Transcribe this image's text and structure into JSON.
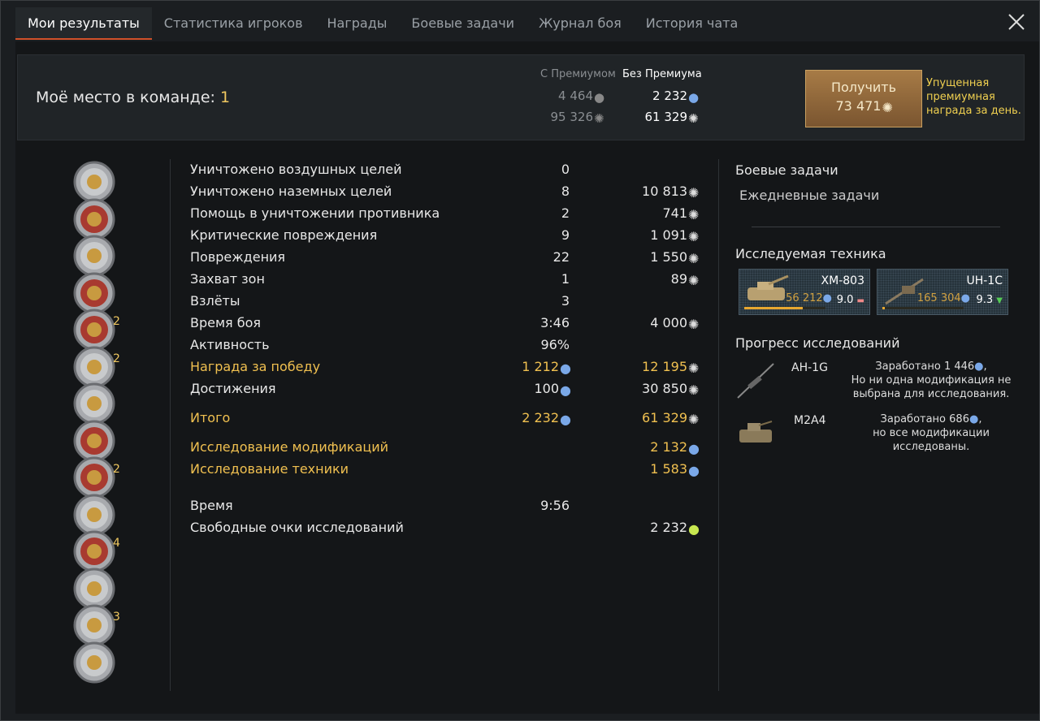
{
  "tabs": [
    {
      "label": "Мои результаты",
      "active": true
    },
    {
      "label": "Статистика игроков"
    },
    {
      "label": "Награды"
    },
    {
      "label": "Боевые задачи"
    },
    {
      "label": "Журнал боя"
    },
    {
      "label": "История чата"
    }
  ],
  "summary": {
    "place_label": "Моё место в команде:",
    "place_value": "1",
    "with_premium": "С Премиумом",
    "without_premium": "Без Премиума",
    "rp_premium": "4 464",
    "rp_base": "2 232",
    "sl_premium": "95 326",
    "sl_base": "61 329",
    "get_label": "Получить",
    "get_amount": "73 471",
    "missed_text": "Упущенная премиумная награда за день."
  },
  "medals": [
    {
      "count": ""
    },
    {
      "count": ""
    },
    {
      "count": ""
    },
    {
      "count": ""
    },
    {
      "count": "2"
    },
    {
      "count": "2"
    },
    {
      "count": ""
    },
    {
      "count": ""
    },
    {
      "count": "2"
    },
    {
      "count": ""
    },
    {
      "count": "4"
    },
    {
      "count": ""
    },
    {
      "count": "3"
    },
    {
      "count": ""
    }
  ],
  "stats": [
    {
      "label": "Уничтожено воздушных целей",
      "value": "0",
      "reward": ""
    },
    {
      "label": "Уничтожено наземных целей",
      "value": "8",
      "reward": "10 813"
    },
    {
      "label": "Помощь в уничтожении противника",
      "value": "2",
      "reward": "741"
    },
    {
      "label": "Критические повреждения",
      "value": "9",
      "reward": "1 091"
    },
    {
      "label": "Повреждения",
      "value": "22",
      "reward": "1 550"
    },
    {
      "label": "Захват зон",
      "value": "1",
      "reward": "89"
    },
    {
      "label": "Взлёты",
      "value": "3",
      "reward": ""
    },
    {
      "label": "Время боя",
      "value": "3:46",
      "reward": "4 000"
    },
    {
      "label": "Активность",
      "value": "96%",
      "reward": ""
    },
    {
      "label": "Награда за победу",
      "value": "1 212",
      "reward": "12 195",
      "gold": true,
      "rp": true
    },
    {
      "label": "Достижения",
      "value": "100",
      "reward": "30 850",
      "rp": true
    }
  ],
  "total": {
    "label": "Итого",
    "value": "2 232",
    "reward": "61 329"
  },
  "research": [
    {
      "label": "Исследование модификаций",
      "value": "2 132"
    },
    {
      "label": "Исследование техники",
      "value": "1 583"
    }
  ],
  "time": {
    "label": "Время",
    "value": "9:56"
  },
  "free_rp": {
    "label": "Свободные очки исследований",
    "value": "2 232"
  },
  "right": {
    "tasks_title": "Боевые задачи",
    "daily": "Ежедневные задачи",
    "researched_title": "Исследуемая техника",
    "vehicles": [
      {
        "name": "XM-803",
        "rp": "56 212",
        "br": "9.0",
        "progress": 0.72,
        "color": "#e88"
      },
      {
        "name": "UH-1C",
        "rp": "165 304",
        "br": "9.3",
        "progress": 0.03,
        "color": "#5c5"
      }
    ],
    "progress_title": "Прогресс исследований",
    "progress": [
      {
        "name": "AH-1G",
        "line1": "Заработано 1 446",
        "line2": "Но ни одна модификация не",
        "line3": "выбрана для исследования."
      },
      {
        "name": "M2A4",
        "line1": "Заработано 686",
        "line2": "но все модификации",
        "line3": "исследованы."
      }
    ]
  },
  "colors": {
    "accent": "#d0502a",
    "gold": "#f0c050",
    "rp": "#7aa8e8"
  }
}
